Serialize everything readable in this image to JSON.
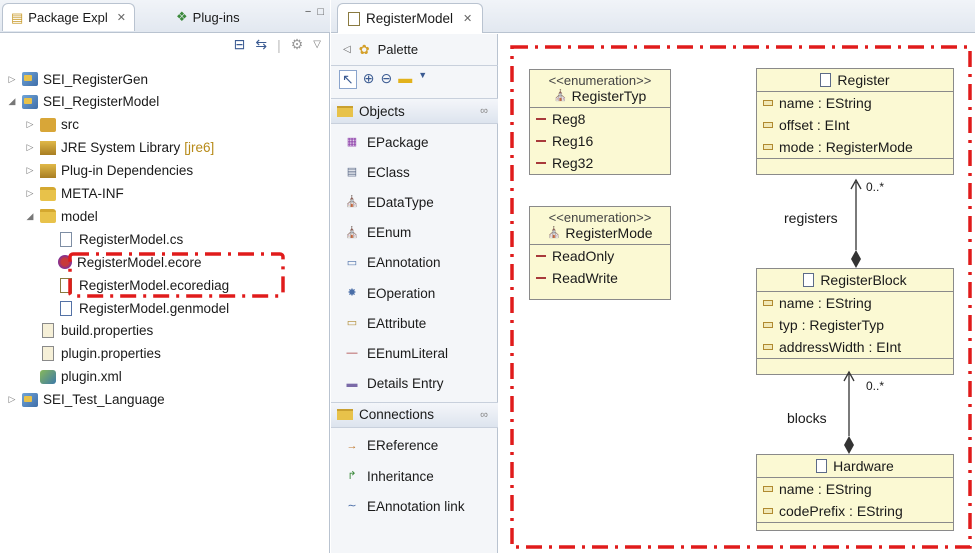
{
  "left_pane": {
    "tabs": [
      {
        "label": "Package Expl",
        "close": "✕"
      },
      {
        "label": "Plug-ins"
      }
    ],
    "window_buttons": [
      "−",
      "□"
    ],
    "tree": [
      {
        "label": "SEI_RegisterGen",
        "icon": "project-icon",
        "indent": 0,
        "arrow": "▷"
      },
      {
        "label": "SEI_RegisterModel",
        "icon": "project-icon",
        "indent": 0,
        "arrow": "◢"
      },
      {
        "label": "src",
        "icon": "source-folder-icon",
        "indent": 1,
        "arrow": "▷"
      },
      {
        "label": "JRE System Library",
        "decoration": "[jre6]",
        "icon": "library-icon",
        "indent": 1,
        "arrow": "▷"
      },
      {
        "label": "Plug-in Dependencies",
        "icon": "library-icon",
        "indent": 1,
        "arrow": "▷"
      },
      {
        "label": "META-INF",
        "icon": "folder-icon",
        "indent": 1,
        "arrow": "▷"
      },
      {
        "label": "model",
        "icon": "folder-icon",
        "indent": 1,
        "arrow": "◢"
      },
      {
        "label": "RegisterModel.cs",
        "icon": "file-icon",
        "indent": 2
      },
      {
        "label": "RegisterModel.ecore",
        "icon": "ecore-file-icon",
        "indent": 2
      },
      {
        "label": "RegisterModel.ecorediag",
        "icon": "diagram-file-icon",
        "indent": 2
      },
      {
        "label": "RegisterModel.genmodel",
        "icon": "genmodel-file-icon",
        "indent": 2
      },
      {
        "label": "build.properties",
        "icon": "properties-file-icon",
        "indent": 1
      },
      {
        "label": "plugin.properties",
        "icon": "properties-file-icon",
        "indent": 1
      },
      {
        "label": "plugin.xml",
        "icon": "plugin-xml-icon",
        "indent": 1
      },
      {
        "label": "SEI_Test_Language",
        "icon": "project-icon",
        "indent": 0,
        "arrow": "▷"
      }
    ]
  },
  "editor": {
    "tab_label": "RegisterModel",
    "tab_close": "✕"
  },
  "palette": {
    "title": "Palette",
    "drawers": [
      {
        "label": "Objects",
        "items": [
          "EPackage",
          "EClass",
          "EDataType",
          "EEnum",
          "EAnnotation",
          "EOperation",
          "EAttribute",
          "EEnumLiteral",
          "Details Entry"
        ]
      },
      {
        "label": "Connections",
        "items": [
          "EReference",
          "Inheritance",
          "EAnnotation link"
        ]
      }
    ]
  },
  "diagram": {
    "enums": [
      {
        "stereotype": "<<enumeration>>",
        "name": "RegisterTyp",
        "literals": [
          "Reg8",
          "Reg16",
          "Reg32"
        ]
      },
      {
        "stereotype": "<<enumeration>>",
        "name": "RegisterMode",
        "literals": [
          "ReadOnly",
          "ReadWrite"
        ]
      }
    ],
    "classes": [
      {
        "name": "Register",
        "attributes": [
          "name : EString",
          "offset : EInt",
          "mode : RegisterMode"
        ]
      },
      {
        "name": "RegisterBlock",
        "attributes": [
          "name : EString",
          "typ : RegisterTyp",
          "addressWidth : EInt"
        ]
      },
      {
        "name": "Hardware",
        "attributes": [
          "name : EString",
          "codePrefix : EString"
        ]
      }
    ],
    "references": [
      {
        "name": "registers",
        "multiplicity": "0..*"
      },
      {
        "name": "blocks",
        "multiplicity": "0..*"
      }
    ]
  },
  "highlight_color": "#e01b1b"
}
